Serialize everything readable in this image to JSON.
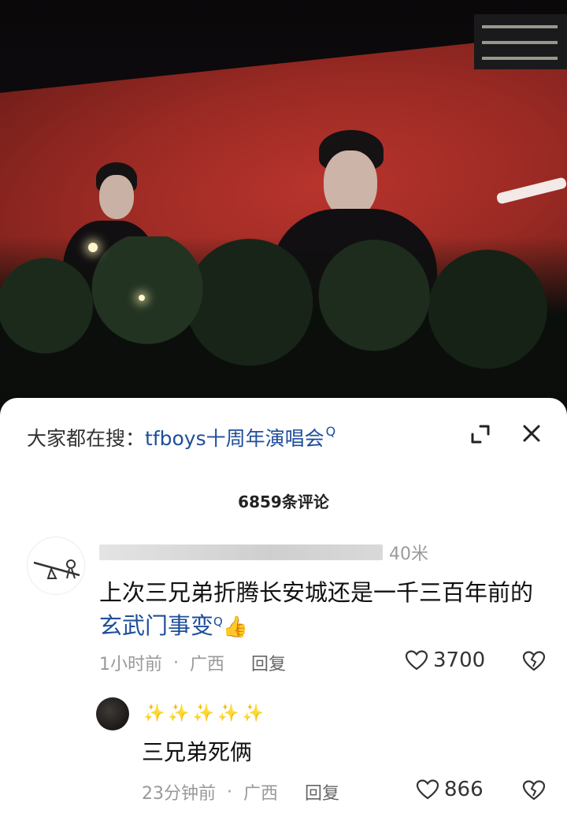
{
  "comments_panel": {
    "search": {
      "prefix": "大家都在搜：",
      "term": "tfboys十周年演唱会",
      "search_mark": "Q"
    },
    "comment_count": "6859条评论",
    "comments": [
      {
        "distance": "40米",
        "text_main": "上次三兄弟折腾长安城还是一千三百年前的",
        "text_link": "玄武门事变",
        "link_mark": "Q",
        "emoji": "👍",
        "time": "1小时前",
        "separator": "·",
        "region": "广西",
        "reply_label": "回复",
        "likes": "3700"
      }
    ],
    "reply": {
      "username": "✨✨✨✨✨",
      "text": "三兄弟死俩",
      "time": "23分钟前",
      "separator": "·",
      "region": "广西",
      "reply_label": "回复",
      "likes": "866"
    }
  },
  "colors": {
    "link": "#1e4e9a",
    "meta": "#999999",
    "screen_red": "#b8342d"
  },
  "icons": [
    "search-suggest-icon",
    "expand-icon",
    "close-icon",
    "heart-icon",
    "broken-heart-icon"
  ]
}
